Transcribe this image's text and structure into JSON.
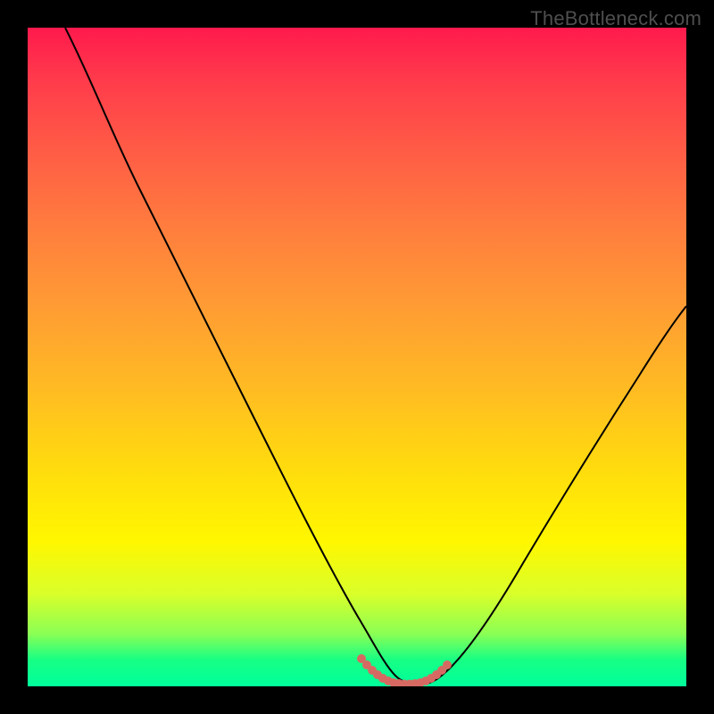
{
  "watermark": "TheBottleneck.com",
  "colors": {
    "curve": "#000000",
    "marker": "#d66a63",
    "frame": "#000000"
  },
  "chart_data": {
    "type": "line",
    "title": "",
    "xlabel": "",
    "ylabel": "",
    "xlim": [
      0,
      100
    ],
    "ylim": [
      0,
      100
    ],
    "series": [
      {
        "name": "bottleneck-curve",
        "x": [
          0,
          4,
          8,
          12,
          16,
          20,
          24,
          28,
          32,
          36,
          40,
          44,
          48,
          50,
          52,
          54,
          56,
          58,
          60,
          62,
          66,
          70,
          74,
          78,
          82,
          86,
          90,
          94,
          98,
          100
        ],
        "y": [
          100,
          94,
          87,
          80,
          73,
          66,
          59,
          52,
          45,
          37,
          29,
          21,
          12,
          8,
          5,
          2,
          0,
          0,
          0,
          2,
          7,
          13,
          19,
          25,
          31,
          37,
          43,
          49,
          54,
          57
        ]
      },
      {
        "name": "sweet-spot-marker",
        "x": [
          50,
          51,
          52,
          53,
          54,
          55,
          56,
          57,
          58,
          59,
          60,
          61,
          62
        ],
        "y": [
          4,
          3,
          2.2,
          1.6,
          1.2,
          0.8,
          0.6,
          0.5,
          0.5,
          0.6,
          0.9,
          1.4,
          2
        ]
      }
    ]
  }
}
